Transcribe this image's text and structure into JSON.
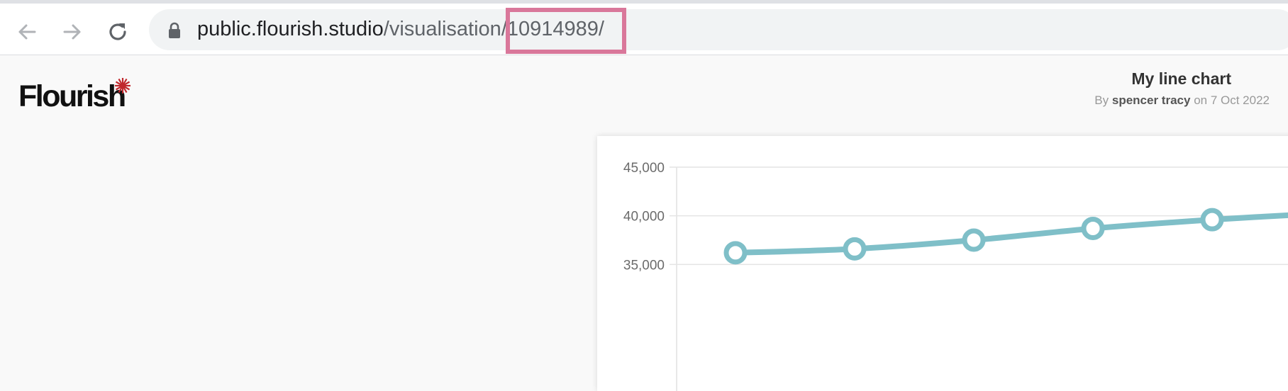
{
  "browser": {
    "back_icon": "arrow-left-icon",
    "forward_icon": "arrow-right-icon",
    "reload_icon": "reload-icon",
    "lock_icon": "lock-icon",
    "url_host": "public.flourish.studio",
    "url_path_prefix": "/visualisatio",
    "url_path_n": "n",
    "url_path_highlighted": "/10914989/",
    "highlight_color": "#d9779a"
  },
  "page": {
    "logo_text": "Flourish",
    "logo_accent_color": "#c0282d",
    "title": "My line chart",
    "byline_prefix": "By",
    "author": "spencer tracy",
    "byline_date": "on 7 Oct 2022"
  },
  "chart_data": {
    "type": "line",
    "title": "",
    "xlabel": "",
    "ylabel": "",
    "ylim": [
      30000,
      45000
    ],
    "yticks": [
      "45,000",
      "40,000",
      "35,000"
    ],
    "grid": true,
    "series": [
      {
        "values": [
          36200,
          36600,
          37500,
          38700,
          39600,
          40300
        ],
        "color": "#7fbfc8"
      }
    ]
  }
}
